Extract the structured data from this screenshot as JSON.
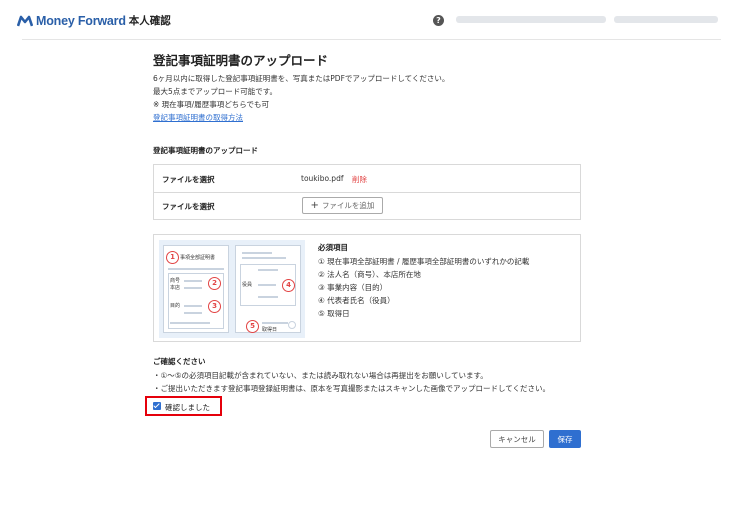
{
  "header": {
    "brand": "Money Forward",
    "brand_sub": "本人確認",
    "help_icon": "?",
    "colors": {
      "brand": "#2a5fa8",
      "accent": "#2f6fd0",
      "danger": "#e24444",
      "highlight": "#e5000b"
    }
  },
  "page": {
    "title": "登記事項証明書のアップロード",
    "desc_lines": [
      "6ヶ月以内に取得した登記事項証明書を、写真またはPDFでアップロードしてください。",
      "最大5点までアップロード可能です。",
      "※ 現在事項/履歴事項どちらでも可"
    ],
    "help_link": "登記事項証明書の取得方法"
  },
  "upload": {
    "section_label": "登記事項証明書のアップロード",
    "rows": [
      {
        "label": "ファイルを選択",
        "filename": "toukibo.pdf",
        "delete": "削除"
      },
      {
        "label": "ファイルを選択",
        "add_button": "ファイルを追加"
      }
    ]
  },
  "illustration": {
    "doc_title": "事項全部証明書",
    "labels": {
      "shogo": "商号",
      "honten": "本店",
      "mokuteki": "目的",
      "yakuin": "役員",
      "date": "取得日"
    },
    "numbers": [
      "1",
      "2",
      "3",
      "4",
      "5"
    ]
  },
  "required": {
    "title": "必須項目",
    "items": [
      "① 現在事項全部証明書 / 履歴事項全部証明書のいずれかの記載",
      "② 法人名（商号）、本店所在地",
      "③ 事業内容（目的）",
      "④ 代表者氏名（役員）",
      "⑤ 取得日"
    ]
  },
  "confirm": {
    "title": "ご確認ください",
    "notes": [
      "・①〜⑤の必須項目記載が含まれていない、または読み取れない場合は再提出をお願いしています。",
      "・ご提出いただきます登記事項登録証明書は、原本を写真撮影またはスキャンした画像でアップロードしてください。"
    ],
    "checkbox_label": "確認しました",
    "checked": true
  },
  "actions": {
    "cancel": "キャンセル",
    "save": "保存"
  }
}
